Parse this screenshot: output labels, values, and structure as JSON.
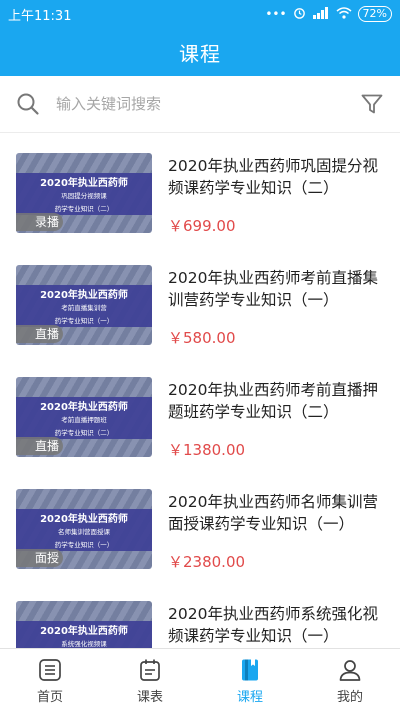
{
  "status_bar": {
    "time": "上午11:31",
    "battery": "72%"
  },
  "header": {
    "title": "课程"
  },
  "search": {
    "placeholder": "输入关键词搜索"
  },
  "courses": [
    {
      "title": "2020年执业西药师巩固提分视频课药学专业知识（二）",
      "price": "￥699.00",
      "thumb_line1": "2020年执业西药师",
      "thumb_line2": "巩固提分视频课",
      "thumb_line3": "药学专业知识（二）",
      "badge": "录播"
    },
    {
      "title": "2020年执业西药师考前直播集训营药学专业知识（一）",
      "price": "￥580.00",
      "thumb_line1": "2020年执业西药师",
      "thumb_line2": "考前直播集训营",
      "thumb_line3": "药学专业知识（一）",
      "badge": "直播"
    },
    {
      "title": "2020年执业西药师考前直播押题班药学专业知识（二）",
      "price": "￥1380.00",
      "thumb_line1": "2020年执业西药师",
      "thumb_line2": "考前直播押题班",
      "thumb_line3": "药学专业知识（二）",
      "badge": "直播"
    },
    {
      "title": "2020年执业西药师名师集训营面授课药学专业知识（一）",
      "price": "￥2380.00",
      "thumb_line1": "2020年执业西药师",
      "thumb_line2": "名师集训营面授课",
      "thumb_line3": "药学专业知识（一）",
      "badge": "面授"
    },
    {
      "title": "2020年执业西药师系统强化视频课药学专业知识（一）",
      "price": "",
      "thumb_line1": "2020年执业西药师",
      "thumb_line2": "系统强化视频课",
      "thumb_line3": "",
      "badge": ""
    }
  ],
  "tabs": [
    {
      "label": "首页",
      "icon": "home-list-icon"
    },
    {
      "label": "课表",
      "icon": "schedule-icon"
    },
    {
      "label": "课程",
      "icon": "course-book-icon",
      "active": true
    },
    {
      "label": "我的",
      "icon": "profile-icon"
    }
  ],
  "colors": {
    "accent": "#1aa7f0",
    "price": "#e14a4a",
    "thumb_band": "#3e4096"
  }
}
